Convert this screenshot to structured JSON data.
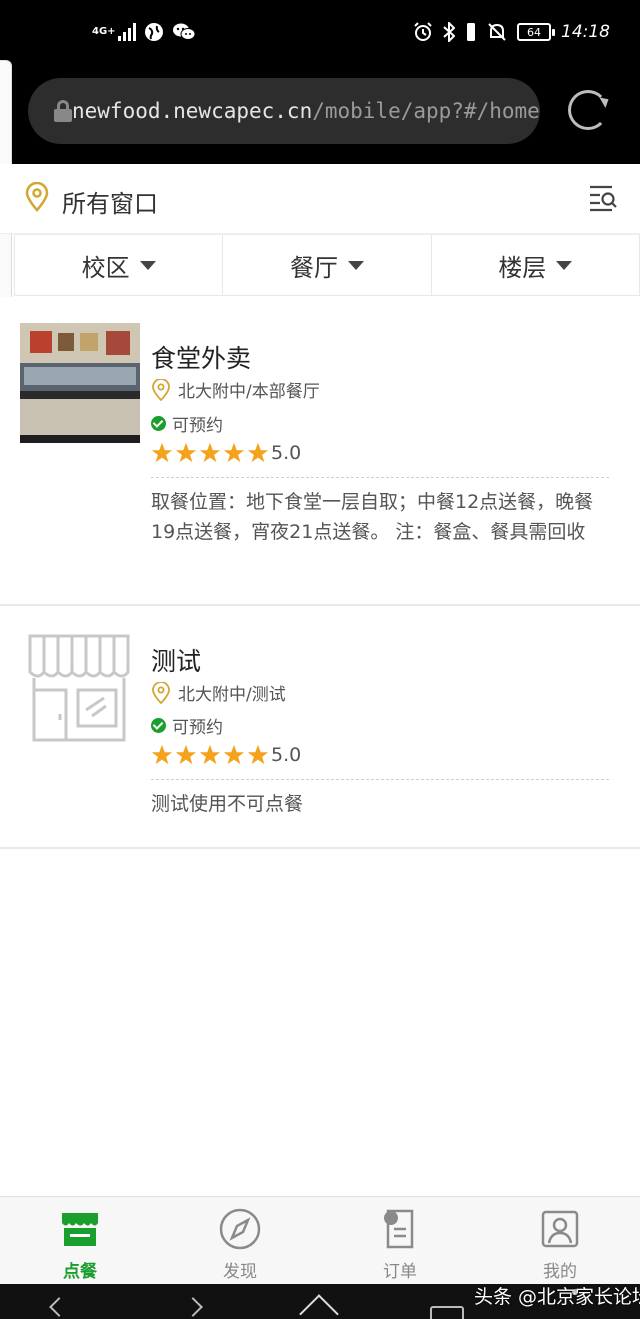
{
  "status_bar": {
    "network": "4G+",
    "time": "14:18",
    "battery": "64"
  },
  "browser": {
    "url_host": "newfood.newcapec.cn",
    "url_path": "/mobile/app?#/home/sl"
  },
  "header": {
    "title": "所有窗口"
  },
  "filters": [
    {
      "label": "校区"
    },
    {
      "label": "餐厅"
    },
    {
      "label": "楼层"
    }
  ],
  "stores": [
    {
      "name": "食堂外卖",
      "location": "北大附中/本部餐厅",
      "status": "可预约",
      "rating": "5.0",
      "stars": 5,
      "description": "取餐位置：地下食堂一层自取；中餐12点送餐，晚餐19点送餐，宵夜21点送餐。 注：餐盒、餐具需回收"
    },
    {
      "name": "测试",
      "location": "北大附中/测试",
      "status": "可预约",
      "rating": "5.0",
      "stars": 5,
      "description": "测试使用不可点餐"
    }
  ],
  "bottom_nav": [
    {
      "label": "点餐",
      "icon": "storefront-icon",
      "active": true
    },
    {
      "label": "发现",
      "icon": "compass-icon",
      "active": false
    },
    {
      "label": "订单",
      "icon": "order-document-icon",
      "active": false
    },
    {
      "label": "我的",
      "icon": "profile-card-icon",
      "active": false
    }
  ],
  "watermark": "头条 @北京家长论坛",
  "colors": {
    "accent_green": "#1a9e2d",
    "star_orange": "#f5a21b",
    "pin_gold": "#d4a531"
  }
}
